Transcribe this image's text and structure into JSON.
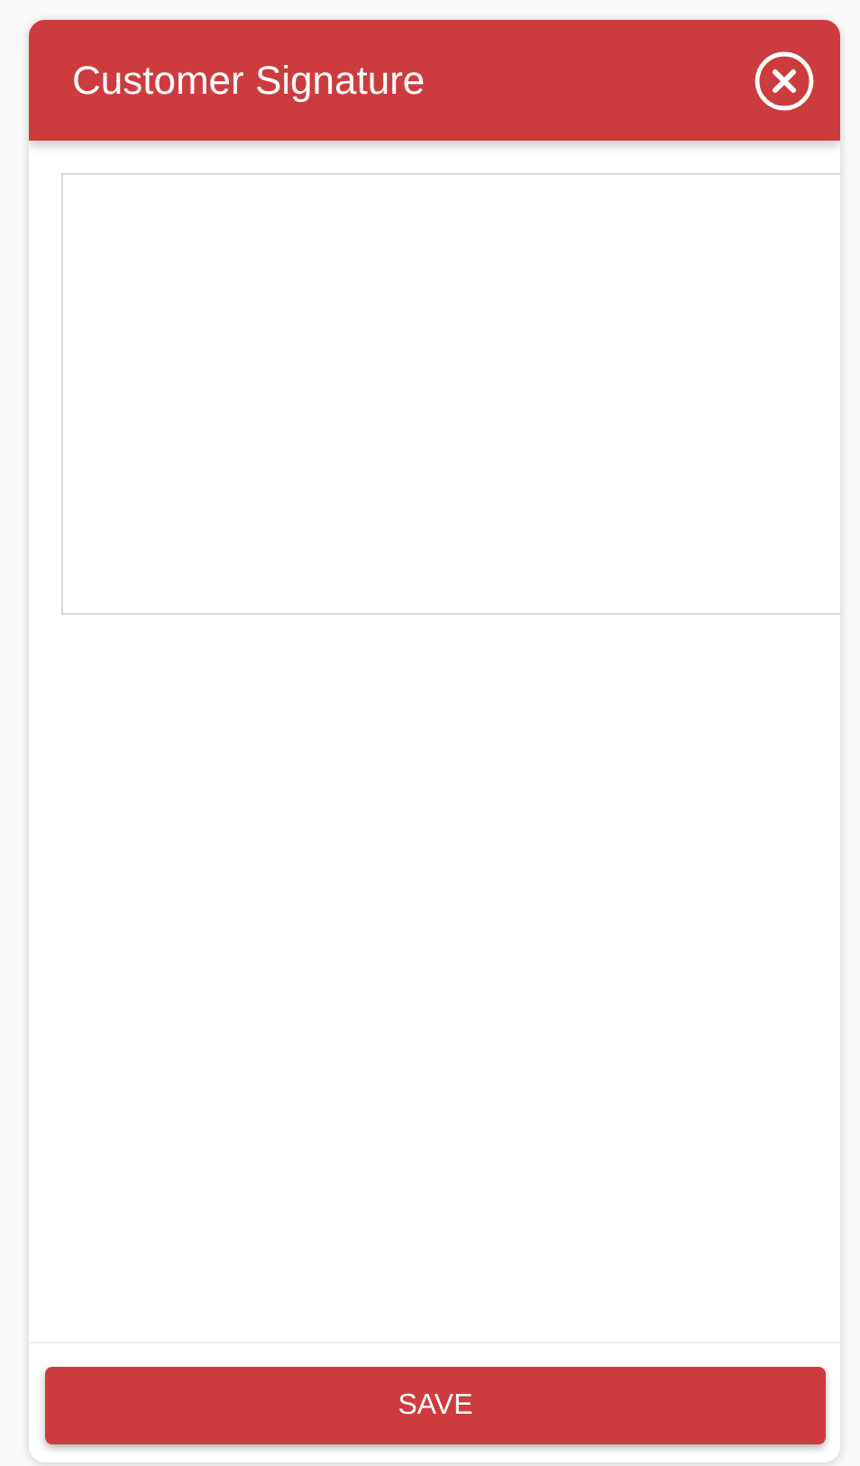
{
  "dialog": {
    "title": "Customer Signature"
  },
  "footer": {
    "button": "SAVE"
  }
}
